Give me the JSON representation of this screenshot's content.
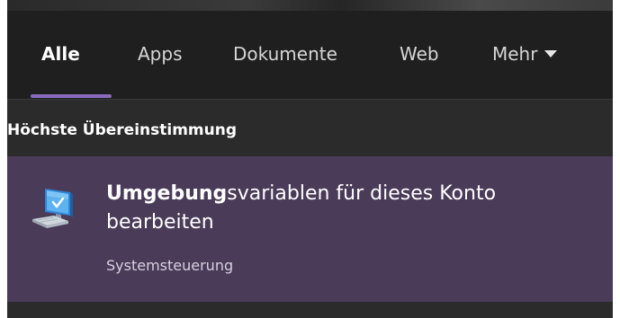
{
  "tabs": [
    {
      "label": "Alle",
      "active": true
    },
    {
      "label": "Apps",
      "active": false
    },
    {
      "label": "Dokumente",
      "active": false
    },
    {
      "label": "Web",
      "active": false
    },
    {
      "label": "Mehr",
      "active": false
    }
  ],
  "accent_color": "#8a6bbe",
  "section": {
    "title": "Höchste Übereinstimmung"
  },
  "best_match": {
    "icon": "control-panel-monitor-icon",
    "title_bold": "Umgebung",
    "title_rest": "svariablen für dieses Konto bearbeiten",
    "subtitle": "Systemsteuerung",
    "highlight_color": "#4a3b59"
  }
}
